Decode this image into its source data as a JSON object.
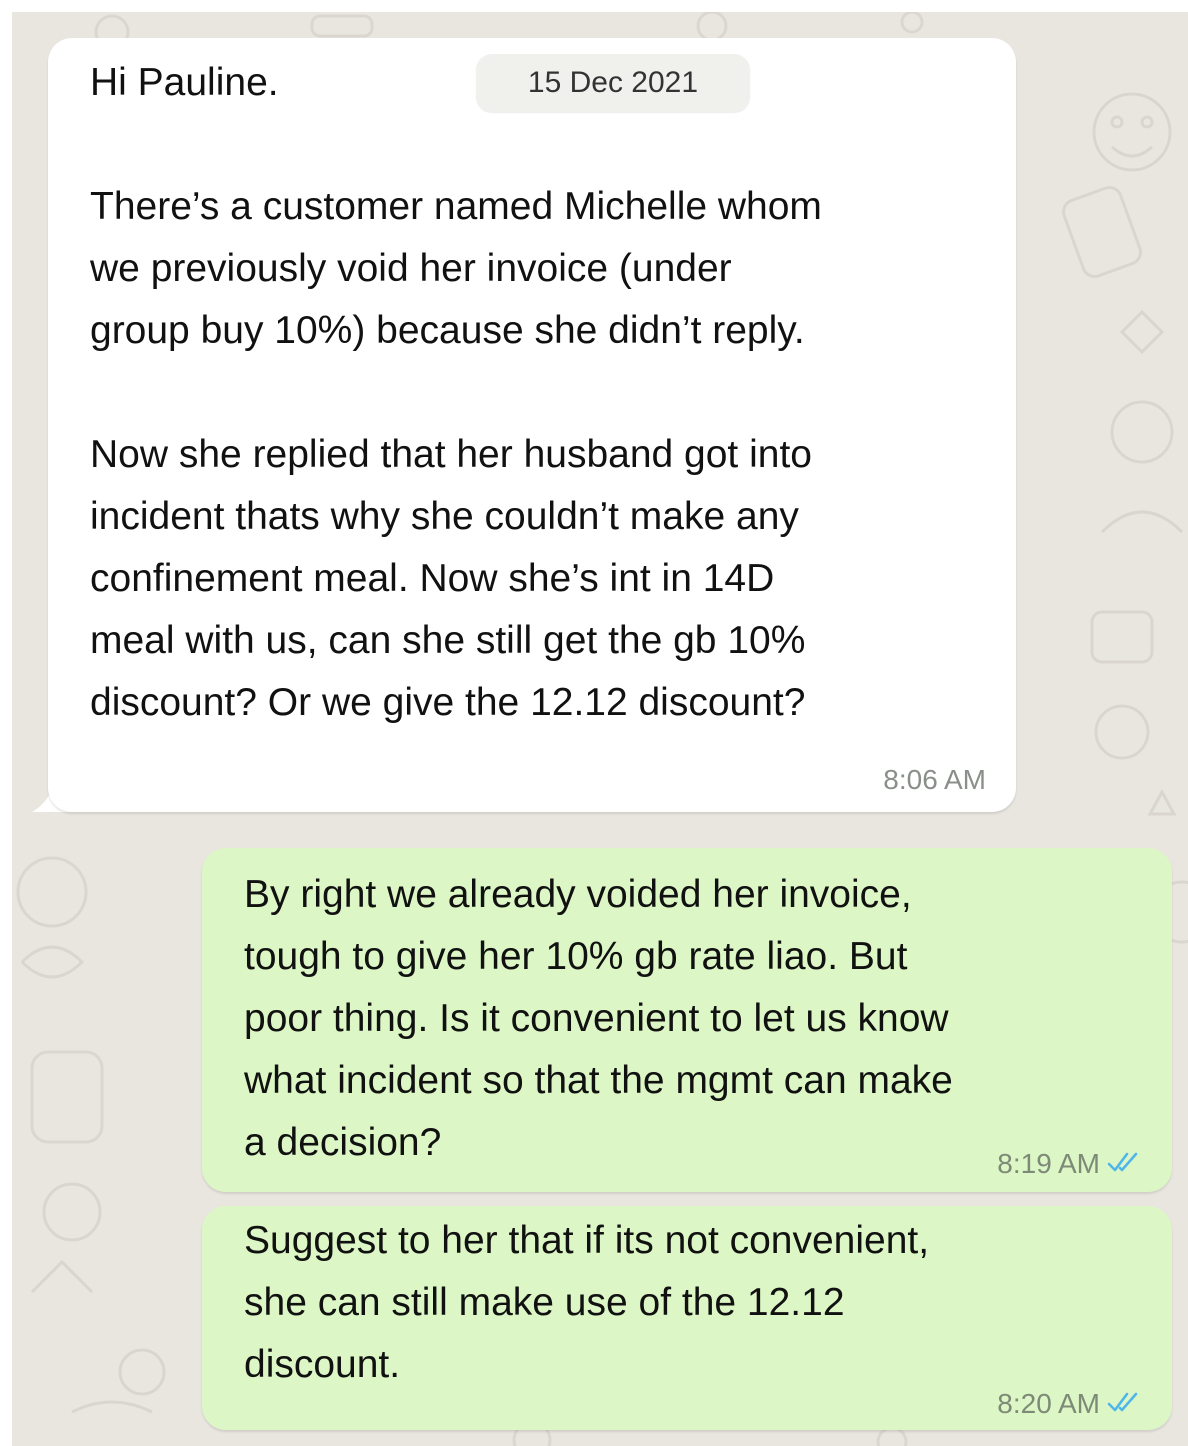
{
  "date_separator": "15 Dec 2021",
  "messages": [
    {
      "direction": "incoming",
      "text": "Hi Pauline.\n\nThere’s a customer named Michelle whom\nwe previously void her invoice (under\ngroup buy 10%) because she didn’t reply.\n\nNow she replied that her husband got into\nincident thats why she couldn’t make any\nconfinement meal. Now she’s int in 14D\nmeal with us, can she still get the gb 10%\ndiscount? Or we give the 12.12 discount?",
      "time": "8:06 AM"
    },
    {
      "direction": "outgoing",
      "text": "By right we already voided her invoice,\ntough to give her 10% gb rate liao. But\npoor thing. Is it convenient to let us know\nwhat incident so that the mgmt can make\na decision?",
      "time": "8:19 AM",
      "status_icon": "double-check-read-icon"
    },
    {
      "direction": "outgoing",
      "text": "Suggest to her that if its not convenient,\nshe can still make use of the 12.12\ndiscount.",
      "time": "8:20 AM",
      "status_icon": "double-check-read-icon"
    }
  ],
  "colors": {
    "background": "#e9e6e0",
    "incoming_bubble": "#ffffff",
    "outgoing_bubble": "#dcf7c5",
    "read_tick": "#4fb6ec"
  }
}
